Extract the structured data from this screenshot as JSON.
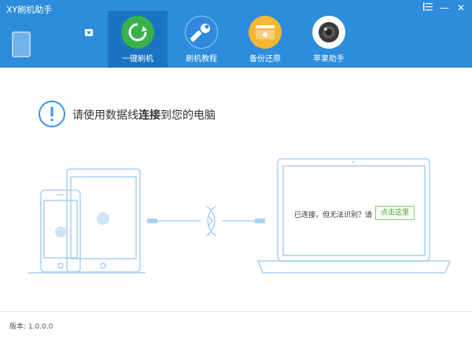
{
  "window": {
    "title": "XY刷机助手"
  },
  "controls": {
    "menu_icon": "menu-icon",
    "minimize_label": "—",
    "close_label": "✕"
  },
  "tabs": [
    {
      "label": "一键刷机",
      "icon": "refresh-icon",
      "color": "#37b34a"
    },
    {
      "label": "刷机教程",
      "icon": "wrench-icon",
      "color": "#2f88dd"
    },
    {
      "label": "备份还原",
      "icon": "backup-icon",
      "color": "#f5b731"
    },
    {
      "label": "苹果助手",
      "icon": "camera-lens-icon",
      "color": "#ffffff"
    }
  ],
  "main": {
    "message_pre": "请使用数据线",
    "message_bold": "连接",
    "message_post": "到您的电脑",
    "prompt": "已连接，但无法识别？请",
    "click_button": "点击这里"
  },
  "status": {
    "version": "版本: 1.0.0.0"
  },
  "colors": {
    "accent": "#2d8ddc",
    "active_tab": "#1a74c2",
    "illustration": "#a8d0f4"
  }
}
